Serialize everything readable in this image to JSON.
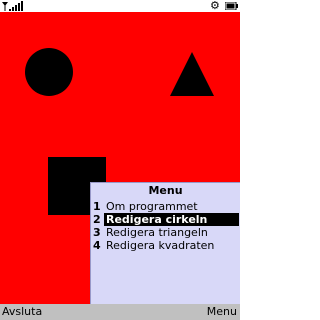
{
  "status_bar": {
    "signal_icon": "signal-strength-icon",
    "settings_icon": "gear-icon",
    "settings_glyph": "⚙",
    "battery_icon": "battery-icon"
  },
  "canvas": {
    "background_color": "#ff0000",
    "shapes": [
      {
        "type": "circle",
        "color": "#000000"
      },
      {
        "type": "triangle",
        "color": "#000000"
      },
      {
        "type": "square",
        "color": "#000000"
      }
    ]
  },
  "menu": {
    "title": "Menu",
    "items": [
      {
        "number": "1",
        "label": "Om programmet",
        "selected": false
      },
      {
        "number": "2",
        "label": "Redigera cirkeln",
        "selected": true
      },
      {
        "number": "3",
        "label": "Redigera triangeln",
        "selected": false
      },
      {
        "number": "4",
        "label": "Redigera kvadraten",
        "selected": false
      }
    ],
    "background_color": "#d8d8f8",
    "highlight_color": "#000000"
  },
  "softkeys": {
    "left_label": "Avsluta",
    "right_label": "Menu",
    "background_color": "#c0c0c0"
  }
}
